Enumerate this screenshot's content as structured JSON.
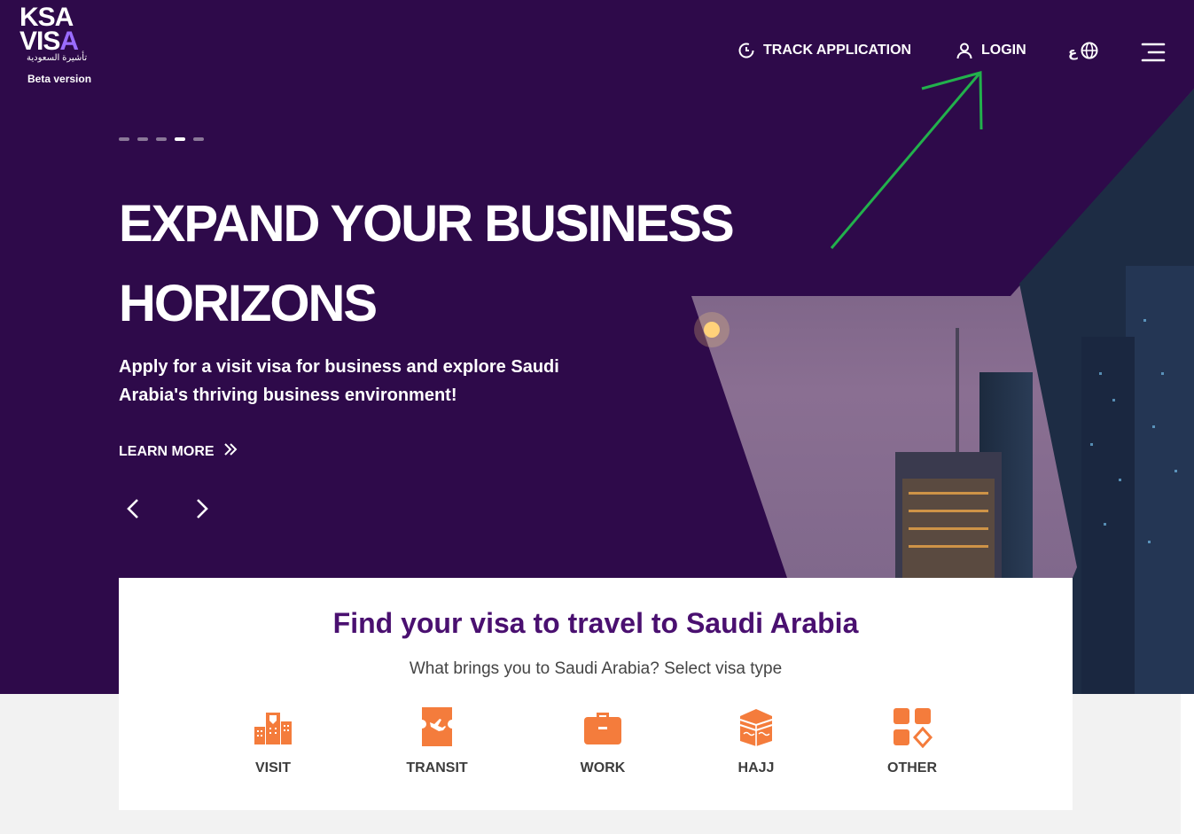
{
  "logo": {
    "line1": "KSA",
    "line2": "VISA",
    "arabic": "تأشيرة السعودية",
    "beta": "Beta version"
  },
  "nav": {
    "track": {
      "label": "TRACK APPLICATION",
      "icon": "clock-icon"
    },
    "login": {
      "label": "LOGIN",
      "icon": "user-icon"
    },
    "language": {
      "label": "ع",
      "icon": "globe-icon"
    },
    "menu": {
      "icon": "menu-icon"
    }
  },
  "hero": {
    "slides_count": 5,
    "active_slide": 4,
    "headline": "EXPAND YOUR BUSINESS HORIZONS",
    "subtext": "Apply for a visit visa for business and explore Saudi Arabia's thriving business environment!",
    "learn_more": "LEARN MORE"
  },
  "finder": {
    "title": "Find your visa to travel to Saudi Arabia",
    "subtitle": "What brings you to Saudi Arabia? Select visa type",
    "types": [
      {
        "label": "VISIT",
        "icon": "buildings-icon"
      },
      {
        "label": "TRANSIT",
        "icon": "transit-ticket-icon"
      },
      {
        "label": "WORK",
        "icon": "briefcase-icon"
      },
      {
        "label": "HAJJ",
        "icon": "kaaba-icon"
      },
      {
        "label": "OTHER",
        "icon": "grid-icon"
      }
    ]
  },
  "colors": {
    "hero_bg": "#2e0a4a",
    "accent_orange": "#f47c3c",
    "title_purple": "#4a1070",
    "annotation_arrow": "#22b14c"
  }
}
